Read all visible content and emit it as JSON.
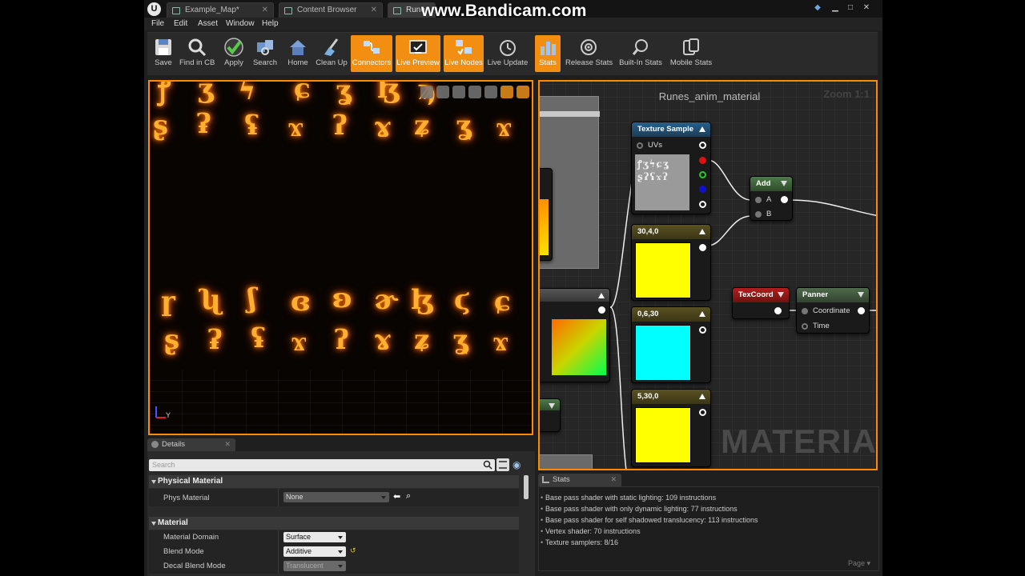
{
  "titlebar": {
    "tabs": [
      "Example_Map*",
      "Content Browser",
      "Rune"
    ],
    "watermark": "www.Bandicam.com"
  },
  "menu": [
    "File",
    "Edit",
    "Asset",
    "Window",
    "Help"
  ],
  "toolbar": [
    {
      "label": "Save",
      "icon": "save-icon",
      "active": false
    },
    {
      "label": "Find in CB",
      "icon": "magnifier-icon",
      "active": false
    },
    {
      "label": "Apply",
      "icon": "checkmark-icon",
      "active": false
    },
    {
      "label": "Search",
      "icon": "search-icon",
      "active": false
    },
    {
      "label": "Home",
      "icon": "home-icon",
      "active": false
    },
    {
      "label": "Clean Up",
      "icon": "broom-icon",
      "active": false
    },
    {
      "label": "Connectors",
      "icon": "connectors-icon",
      "active": true
    },
    {
      "label": "Live Preview",
      "icon": "live-preview-icon",
      "active": true
    },
    {
      "label": "Live Nodes",
      "icon": "live-nodes-icon",
      "active": true
    },
    {
      "label": "Live Update",
      "icon": "live-update-icon",
      "active": false
    },
    {
      "label": "Stats",
      "icon": "stats-icon",
      "active": true
    },
    {
      "label": "Release Stats",
      "icon": "release-stats-icon",
      "active": false
    },
    {
      "label": "Built-In Stats",
      "icon": "built-in-stats-icon",
      "active": false
    },
    {
      "label": "Mobile Stats",
      "icon": "mobile-stats-icon",
      "active": false
    }
  ],
  "viewport": {
    "axis_label": "Y"
  },
  "graph": {
    "title": "Runes_anim_material",
    "zoom": "Zoom 1:1",
    "watermark": "MATERIAL",
    "nodes": {
      "texture_sample": {
        "title": "Texture Sample",
        "input": "UVs"
      },
      "add": {
        "title": "Add",
        "in_a": "A",
        "in_b": "B"
      },
      "const1": {
        "title": "30,4,0",
        "color": "#ffff00"
      },
      "const2": {
        "title": "0,6,30",
        "color": "#00ffff"
      },
      "const3": {
        "title": "5,30,0",
        "color": "#ffff00"
      },
      "texcoord": {
        "title": "TexCoord"
      },
      "panner": {
        "title": "Panner",
        "in_coord": "Coordinate",
        "in_time": "Time"
      }
    }
  },
  "details": {
    "tab": "Details",
    "search_placeholder": "Search",
    "sections": {
      "physical": "Physical Material",
      "material": "Material"
    },
    "props": {
      "phys_material": {
        "label": "Phys Material",
        "value": "None"
      },
      "material_domain": {
        "label": "Material Domain",
        "value": "Surface"
      },
      "blend_mode": {
        "label": "Blend Mode",
        "value": "Additive"
      },
      "decal_blend_mode": {
        "label": "Decal Blend Mode",
        "value": "Translucent"
      }
    }
  },
  "stats": {
    "tab": "Stats",
    "lines": [
      "Base pass shader with static lighting: 109 instructions",
      "Base pass shader with only dynamic lighting: 77 instructions",
      "Base pass shader for self shadowed translucency: 113 instructions",
      "Vertex shader: 70 instructions",
      "Texture samplers: 8/16"
    ],
    "page_label": "Page"
  }
}
